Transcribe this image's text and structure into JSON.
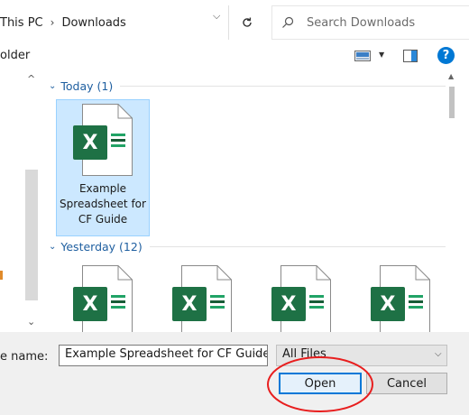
{
  "address": {
    "crumbs": [
      "This PC",
      "Downloads"
    ],
    "separator": "›"
  },
  "search": {
    "placeholder": "Search Downloads"
  },
  "toolbar": {
    "new_folder_partial": "older"
  },
  "groups": [
    {
      "label": "Today (1)"
    },
    {
      "label": "Yesterday (12)"
    }
  ],
  "files": {
    "today": [
      {
        "name": "Example Spreadsheet for CF Guide",
        "name_lines": [
          "Example",
          "Spreadsheet for",
          "CF Guide"
        ],
        "icon": "excel-file-icon",
        "selected": true
      }
    ],
    "yesterday_count_visible": 4
  },
  "bottom": {
    "filename_label": "e name:",
    "filename_value": "Example Spreadsheet for CF Guide",
    "filter_value": "All Files",
    "open_label": "Open",
    "cancel_label": "Cancel"
  },
  "colors": {
    "accent": "#0078d4",
    "excel_green": "#1e7145",
    "annotation_red": "#e81e1e",
    "selection_bg": "#cce8ff"
  }
}
